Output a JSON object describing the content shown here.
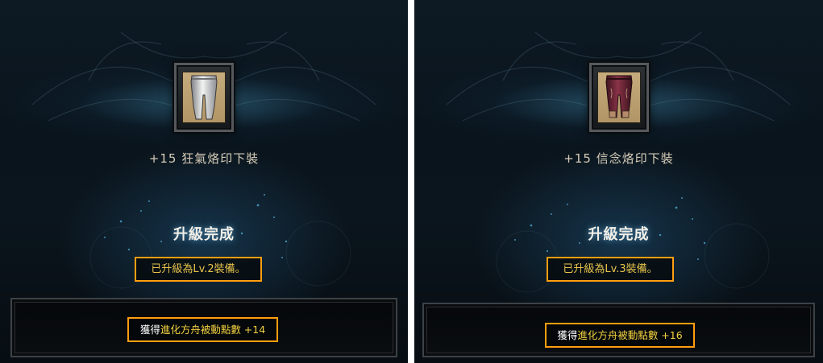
{
  "panels": [
    {
      "item_name": "+15 狂氣烙印下裝",
      "title": "升級完成",
      "level_message": "已升級為Lv.2裝備。",
      "reward_prefix": "獲得",
      "reward_text": "進化方舟被動點數 +14",
      "item_icon": "silver-leggings-icon"
    },
    {
      "item_name": "+15 信念烙印下裝",
      "title": "升級完成",
      "level_message": "已升級為Lv.3裝備。",
      "reward_prefix": "獲得",
      "reward_text": "進化方舟被動點數 +16",
      "item_icon": "crimson-leggings-icon"
    }
  ],
  "colors": {
    "highlight_border": "#ff9e0f",
    "gold_text": "#e8c44c",
    "reward_text": "#f2d040"
  }
}
